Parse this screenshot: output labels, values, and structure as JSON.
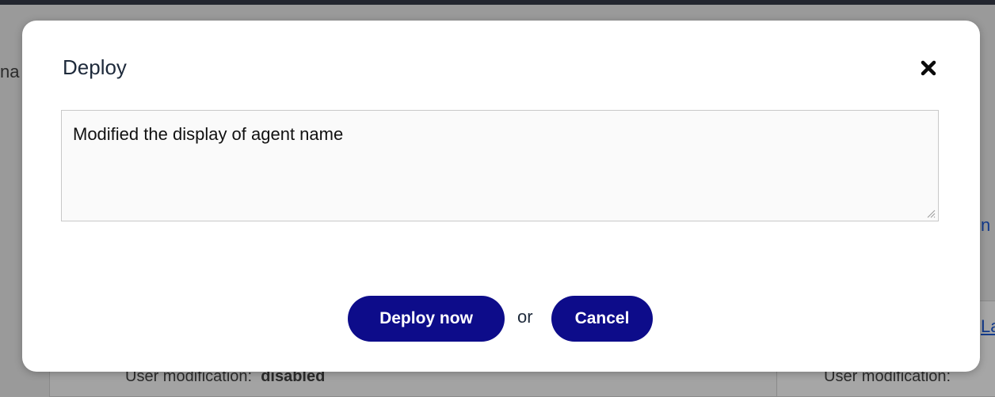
{
  "background": {
    "left_edge_text": "na",
    "right_link_1": "n",
    "right_link_2": "La",
    "left_user_mod_label": "User modification:",
    "left_user_mod_value": "disabled",
    "right_user_mod_label": "User modification:"
  },
  "dialog": {
    "title": "Deploy",
    "close_icon": "close-icon",
    "comment_value": "Modified the display of agent name",
    "deploy_label": "Deploy now",
    "or_label": "or",
    "cancel_label": "Cancel"
  },
  "colors": {
    "button_bg": "#0d0c8a",
    "overlay": "#9a9a9a",
    "link": "#123a8c"
  }
}
